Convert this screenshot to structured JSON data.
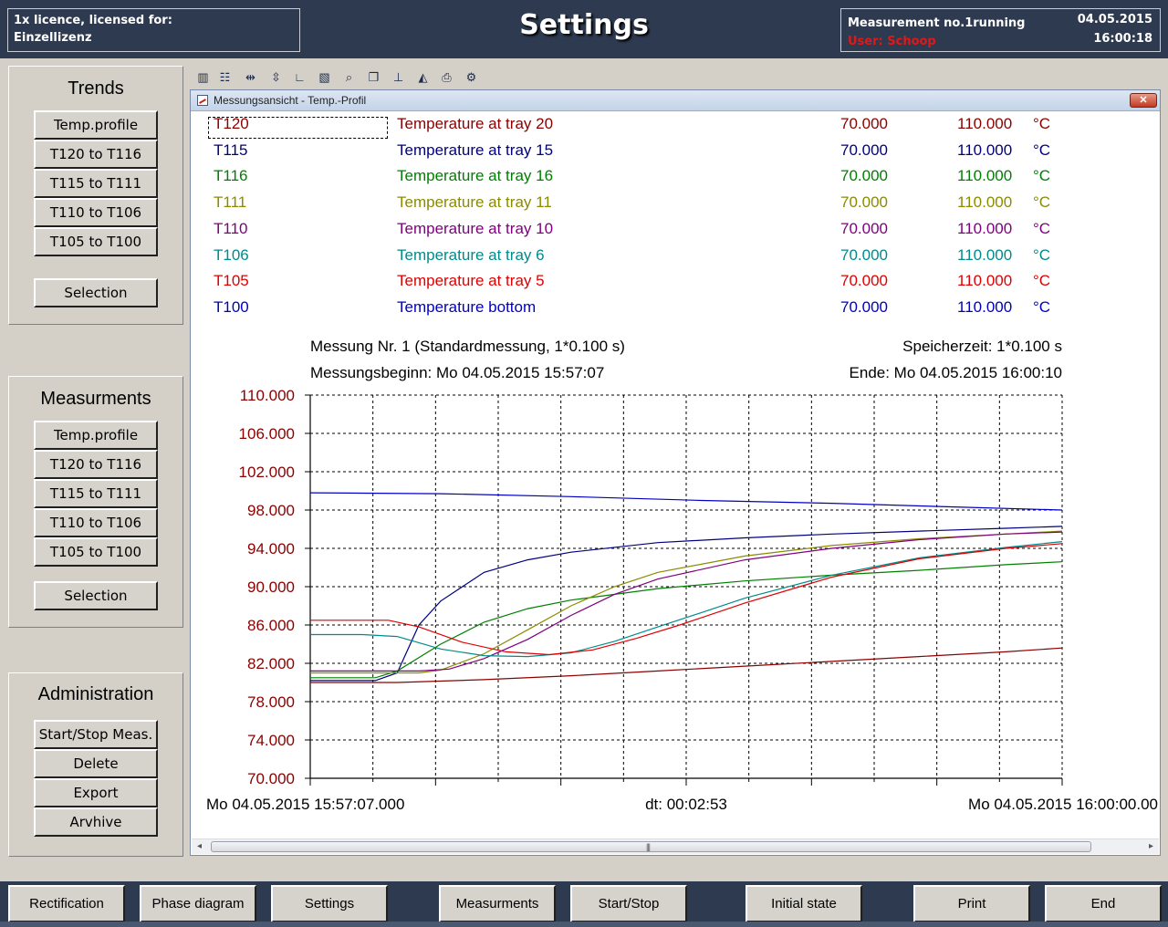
{
  "header": {
    "licence_line1": "1x licence, licensed for:",
    "licence_line2": "Einzellizenz",
    "title": "Settings",
    "measurement_status": "Measurement no.1running",
    "user": "User: Schoop",
    "date": "04.05.2015",
    "time": "16:00:18"
  },
  "trends": {
    "title": "Trends",
    "buttons": [
      "Temp.profile",
      "T120 to T116",
      "T115 to T111",
      "T110 to T106",
      "T105 to T100"
    ],
    "selection": "Selection"
  },
  "measurements_panel": {
    "title": "Measurments",
    "buttons": [
      "Temp.profile",
      "T120 to T116",
      "T115 to T111",
      "T110 to T106",
      "T105 to T100"
    ],
    "selection": "Selection"
  },
  "administration": {
    "title": "Administration",
    "buttons": [
      "Start/Stop Meas.",
      "Delete",
      "Export",
      "Arvhive"
    ]
  },
  "toolbar_icons": [
    "chart-icon",
    "table-icon",
    "axis-x-icon",
    "axis-y-icon",
    "axis-icon",
    "scale-icon",
    "zoom-icon",
    "copy-icon",
    "ruler-icon",
    "print-preview-icon",
    "print-icon",
    "settings-icon"
  ],
  "window": {
    "title": "Messungsansicht - Temp.-Profil",
    "close_label": "✕"
  },
  "legend": [
    {
      "tag": "T120",
      "desc": "Temperature at tray 20",
      "min": "70.000",
      "max": "110.000",
      "unit": "°C",
      "color": "#8b0000"
    },
    {
      "tag": "T115",
      "desc": "Temperature at tray 15",
      "min": "70.000",
      "max": "110.000",
      "unit": "°C",
      "color": "#000080"
    },
    {
      "tag": "T116",
      "desc": "Temperature at tray 16",
      "min": "70.000",
      "max": "110.000",
      "unit": "°C",
      "color": "#008000"
    },
    {
      "tag": "T111",
      "desc": "Temperature at tray 11",
      "min": "70.000",
      "max": "110.000",
      "unit": "°C",
      "color": "#8b8b00"
    },
    {
      "tag": "T110",
      "desc": "Temperature at tray 10",
      "min": "70.000",
      "max": "110.000",
      "unit": "°C",
      "color": "#800080"
    },
    {
      "tag": "T106",
      "desc": "Temperature at tray 6",
      "min": "70.000",
      "max": "110.000",
      "unit": "°C",
      "color": "#008b8b"
    },
    {
      "tag": "T105",
      "desc": "Temperature at tray 5",
      "min": "70.000",
      "max": "110.000",
      "unit": "°C",
      "color": "#e00000"
    },
    {
      "tag": "T100",
      "desc": "Temperature bottom",
      "min": "70.000",
      "max": "110.000",
      "unit": "°C",
      "color": "#0000c0"
    }
  ],
  "chart_info": {
    "measurement": "Messung Nr. 1 (Standardmessung, 1*0.100 s)",
    "storage_time": "Speicherzeit: 1*0.100 s",
    "start": "Messungsbeginn: Mo 04.05.2015 15:57:07",
    "end": "Ende: Mo 04.05.2015 16:00:10",
    "x_start_label": "Mo 04.05.2015 15:57:07.000",
    "dt_label": "dt: 00:02:53",
    "x_end_label": "Mo 04.05.2015 16:00:00.00"
  },
  "chart_data": {
    "type": "line",
    "ylim": [
      70,
      110
    ],
    "yticks": [
      "110.000",
      "106.000",
      "102.000",
      "98.000",
      "94.000",
      "90.000",
      "86.000",
      "82.000",
      "78.000",
      "74.000",
      "70.000"
    ],
    "xlim": [
      0,
      173
    ],
    "x_unit": "seconds since 04.05.2015 15:57:07",
    "grid": true,
    "series": [
      {
        "name": "T120",
        "color": "#8b0000",
        "x": [
          0,
          20,
          40,
          60,
          80,
          100,
          120,
          140,
          160,
          173
        ],
        "y": [
          80.0,
          80.0,
          80.3,
          80.7,
          81.2,
          81.7,
          82.2,
          82.7,
          83.2,
          83.6
        ]
      },
      {
        "name": "T115",
        "color": "#000080",
        "x": [
          0,
          15,
          20,
          25,
          30,
          40,
          50,
          60,
          80,
          100,
          120,
          140,
          160,
          173
        ],
        "y": [
          80.2,
          80.2,
          81.0,
          86.0,
          88.5,
          91.5,
          92.8,
          93.6,
          94.6,
          95.1,
          95.5,
          95.8,
          96.1,
          96.3
        ]
      },
      {
        "name": "T116",
        "color": "#008000",
        "x": [
          0,
          15,
          20,
          30,
          40,
          50,
          60,
          80,
          100,
          120,
          140,
          160,
          173
        ],
        "y": [
          80.5,
          80.5,
          81.2,
          84.0,
          86.3,
          87.7,
          88.6,
          89.8,
          90.6,
          91.2,
          91.7,
          92.3,
          92.6
        ]
      },
      {
        "name": "T111",
        "color": "#8b8b00",
        "x": [
          0,
          25,
          30,
          40,
          50,
          60,
          70,
          80,
          100,
          120,
          140,
          160,
          173
        ],
        "y": [
          81.0,
          81.0,
          81.3,
          83.0,
          85.5,
          88.0,
          90.0,
          91.5,
          93.2,
          94.3,
          95.0,
          95.5,
          95.8
        ]
      },
      {
        "name": "T110",
        "color": "#800080",
        "x": [
          0,
          25,
          32,
          40,
          50,
          60,
          70,
          80,
          100,
          120,
          140,
          160,
          173
        ],
        "y": [
          81.2,
          81.2,
          81.4,
          82.5,
          84.5,
          87.0,
          89.2,
          90.8,
          92.8,
          94.0,
          94.9,
          95.5,
          95.7
        ]
      },
      {
        "name": "T106",
        "color": "#008b8b",
        "x": [
          0,
          12,
          20,
          30,
          40,
          50,
          60,
          70,
          80,
          90,
          100,
          120,
          140,
          160,
          173
        ],
        "y": [
          85.0,
          85.0,
          84.8,
          83.5,
          82.8,
          82.7,
          83.1,
          84.3,
          85.8,
          87.3,
          88.8,
          91.2,
          93.0,
          94.1,
          94.7
        ]
      },
      {
        "name": "T105",
        "color": "#e00000",
        "x": [
          0,
          18,
          25,
          35,
          45,
          55,
          65,
          75,
          85,
          100,
          120,
          140,
          160,
          173
        ],
        "y": [
          86.5,
          86.5,
          85.8,
          84.2,
          83.2,
          82.9,
          83.4,
          84.6,
          86.0,
          88.3,
          91.0,
          92.9,
          94.0,
          94.5
        ]
      },
      {
        "name": "T100",
        "color": "#0000c0",
        "x": [
          0,
          30,
          60,
          90,
          120,
          150,
          173
        ],
        "y": [
          99.8,
          99.7,
          99.4,
          99.0,
          98.7,
          98.3,
          98.0
        ]
      }
    ]
  },
  "bottom_nav": [
    "Rectification",
    "Phase diagram",
    "Settings",
    "Measurments",
    "Start/Stop",
    "Initial state",
    "Print",
    "End"
  ]
}
